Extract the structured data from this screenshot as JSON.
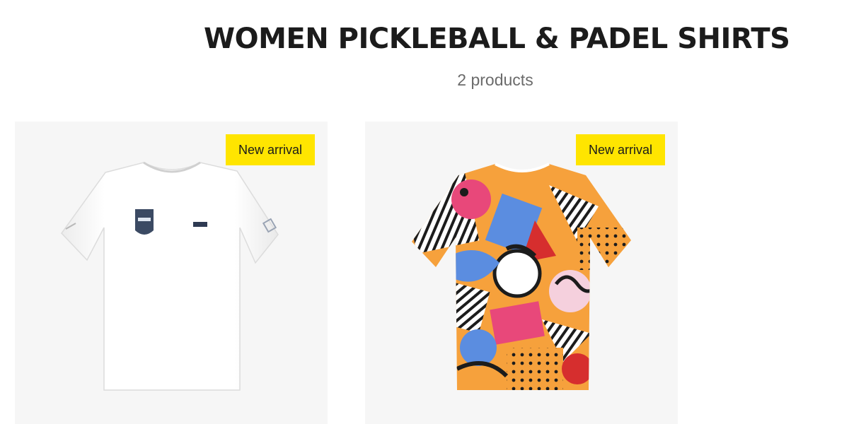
{
  "collection": {
    "title": "WOMEN PICKLEBALL & PADEL SHIRTS",
    "count_text": "2 products"
  },
  "products": [
    {
      "badge": "New arrival",
      "image": "white-tshirt-with-badge-logo",
      "shirt_color": "#ffffff",
      "logo_color": "#3b4a63"
    },
    {
      "badge": "New arrival",
      "image": "multicolor-abstract-print-tshirt",
      "shirt_color": "#f6a13c",
      "pattern_colors": [
        "#f6a13c",
        "#5b8de0",
        "#e8487a",
        "#1c1c1c",
        "#ffffff",
        "#d62e2e",
        "#f5d0dd"
      ]
    }
  ]
}
